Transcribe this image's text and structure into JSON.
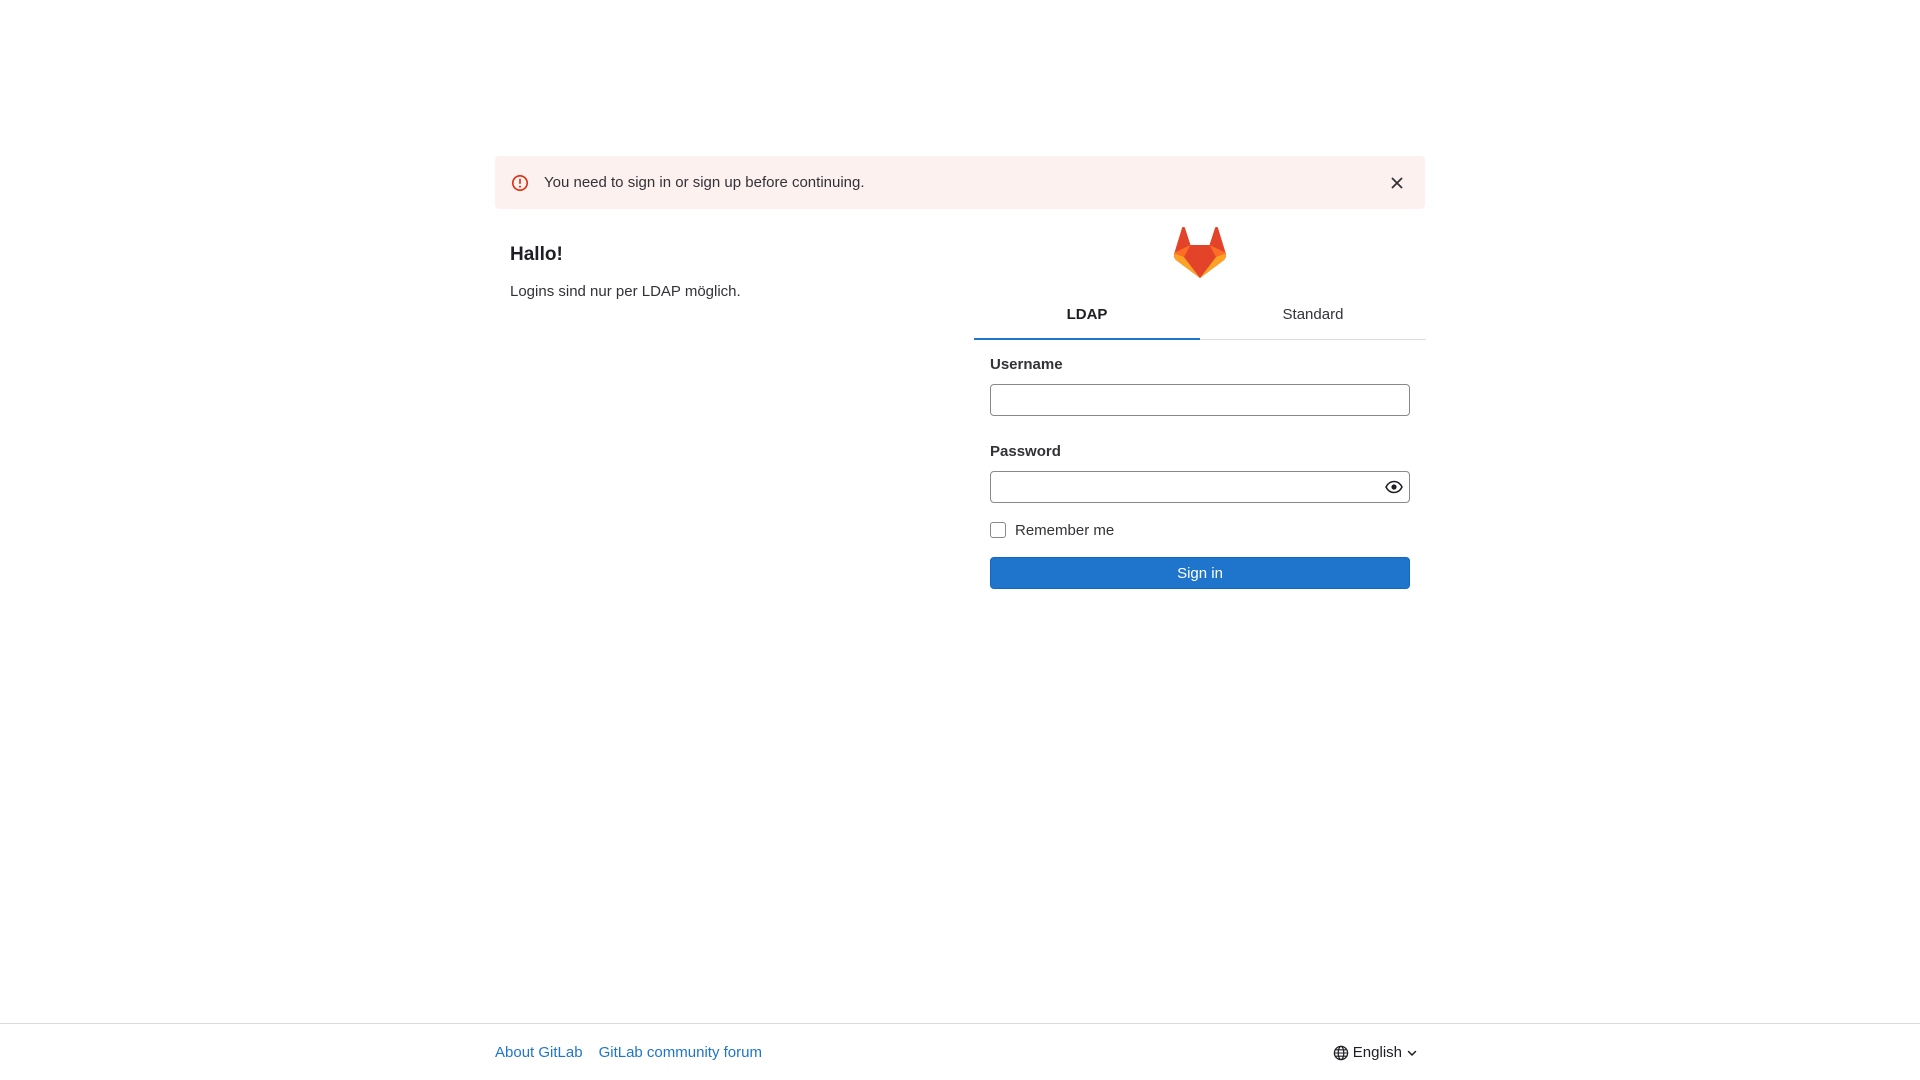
{
  "alert": {
    "message": "You need to sign in or sign up before continuing.",
    "icon": "error-icon",
    "dismiss_icon": "close-icon"
  },
  "intro": {
    "title": "Hallo!",
    "description": "Logins sind nur per LDAP möglich."
  },
  "tabs": [
    {
      "label": "LDAP",
      "active": true
    },
    {
      "label": "Standard",
      "active": false
    }
  ],
  "form": {
    "username_label": "Username",
    "username_value": "",
    "password_label": "Password",
    "password_value": "",
    "remember_label": "Remember me",
    "remember_checked": false,
    "submit_label": "Sign in"
  },
  "footer": {
    "links": [
      {
        "label": "About GitLab"
      },
      {
        "label": "GitLab community forum"
      }
    ],
    "language": "English"
  },
  "colors": {
    "primary": "#1f75cb",
    "alert_bg": "#fcf1ef",
    "alert_icon": "#dd2b0e",
    "logo_orange_dark": "#e24329",
    "logo_orange": "#fc6d26",
    "logo_orange_light": "#fca326"
  }
}
